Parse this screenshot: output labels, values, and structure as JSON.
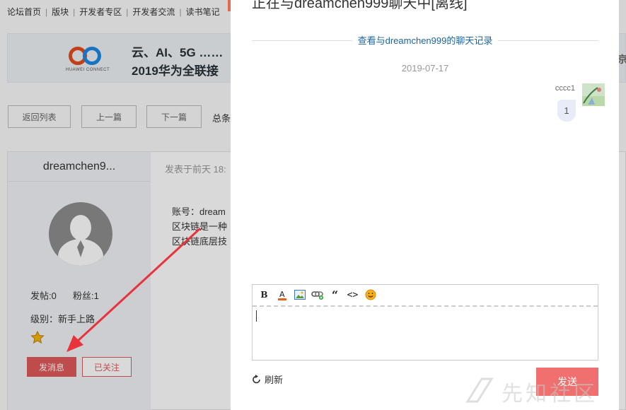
{
  "breadcrumb": [
    "论坛首页",
    "版块",
    "开发者专区",
    "开发者交流",
    "读书笔记"
  ],
  "banner": {
    "brand": "HUAWEI CONNECT",
    "line1": "云、AI、5G ……",
    "line2": "2019华为全联接",
    "right_fragment": "京"
  },
  "nav": {
    "back": "返回列表",
    "prev": "上一篇",
    "next": "下一篇",
    "total": "总条"
  },
  "post": {
    "author": "dreamchen9...",
    "meta": "发表于前天 18:",
    "lines": [
      "账号：dream",
      "区块链是一种",
      "区块链底层技"
    ]
  },
  "user": {
    "posts_label": "发帖:0",
    "fans_label": "粉丝:1",
    "level_label": "级别：新手上路",
    "message_button": "发消息",
    "follow_button": "已关注"
  },
  "chat": {
    "title": "正在与dreamchen999聊天中[离线]",
    "history_link": "查看与dreamchen999的聊天记录",
    "date": "2019-07-17",
    "messages": [
      {
        "sender": "cccc1",
        "text": "1"
      }
    ],
    "input_value": "",
    "refresh_label": "刷新",
    "send_label": "发送",
    "toolbar": [
      "bold",
      "font-color",
      "image",
      "link",
      "quote",
      "code",
      "emoji"
    ]
  },
  "watermark": "先知社区",
  "colors": {
    "accent_red": "#e05a5a",
    "send_button": "#f07070",
    "link_blue": "#1d64a5",
    "bubble": "#e8ecf9"
  }
}
